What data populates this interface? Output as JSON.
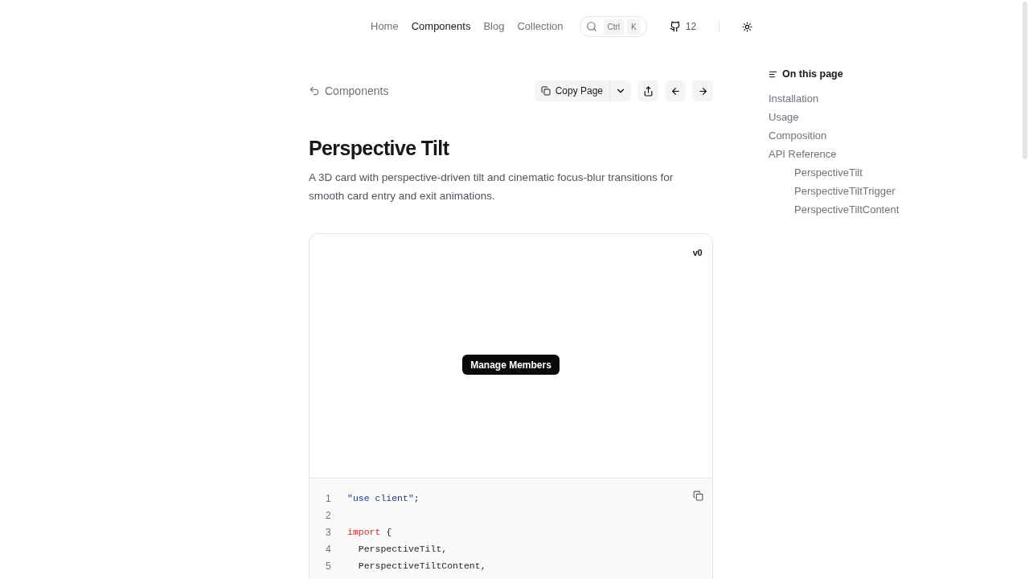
{
  "nav": {
    "links": [
      {
        "label": "Home",
        "selected": false
      },
      {
        "label": "Components",
        "selected": true
      },
      {
        "label": "Blog",
        "selected": false
      },
      {
        "label": "Collection",
        "selected": false
      }
    ],
    "search": {
      "keys": [
        "Ctrl",
        "K"
      ]
    },
    "github": {
      "stars": "12"
    }
  },
  "breadcrumb": {
    "label": "Components"
  },
  "toolbar": {
    "copy_label": "Copy Page"
  },
  "title": "Perspective Tilt",
  "description": "A 3D card with perspective-driven tilt and cinematic focus-blur transitions for smooth card entry and exit animations.",
  "preview": {
    "logo": "v0",
    "button": "Manage Members"
  },
  "code": [
    {
      "number": "1",
      "tokens": [
        {
          "kind": "string",
          "text": "\"use client\""
        },
        {
          "kind": "plain",
          "text": ";"
        }
      ]
    },
    {
      "number": "2"
    },
    {
      "number": "3",
      "tokens": [
        {
          "kind": "keyword",
          "text": "import"
        },
        {
          "kind": "plain",
          "text": " {"
        }
      ]
    },
    {
      "number": "4",
      "tokens": [
        {
          "kind": "plain",
          "text": "  PerspectiveTilt,"
        }
      ]
    },
    {
      "number": "5",
      "tokens": [
        {
          "kind": "plain",
          "text": "  PerspectiveTiltContent,"
        }
      ]
    }
  ],
  "toc": {
    "title": "On this page",
    "items": [
      {
        "label": "Installation"
      },
      {
        "label": "Usage"
      },
      {
        "label": "Composition"
      },
      {
        "label": "API Reference",
        "children": [
          {
            "label": "PerspectiveTilt"
          },
          {
            "label": "PerspectiveTiltTrigger"
          },
          {
            "label": "PerspectiveTiltContent"
          }
        ]
      }
    ]
  }
}
